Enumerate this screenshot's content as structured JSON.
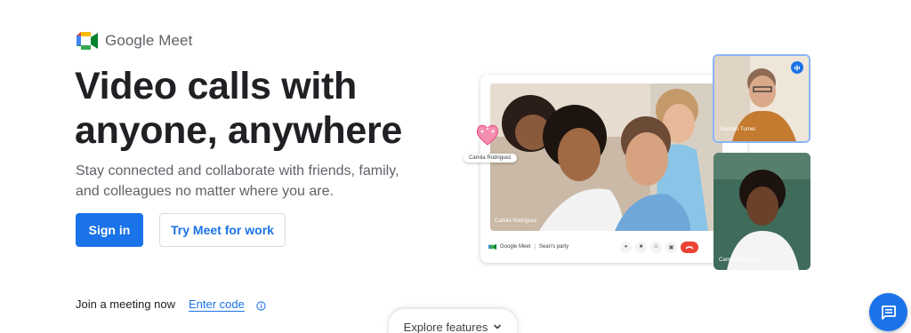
{
  "brand": {
    "name": "Google Meet",
    "icon": "google-meet-logo",
    "colors": {
      "blue": "#4285f4",
      "green": "#34a853",
      "yellow": "#fbbc04",
      "red": "#ea4335"
    }
  },
  "hero": {
    "title_line1": "Video calls with",
    "title_line2": "anyone, anywhere",
    "subtitle": "Stay connected and collaborate with friends, family, and colleagues no matter where you are."
  },
  "actions": {
    "sign_in": "Sign in",
    "try_meet": "Try Meet for work"
  },
  "join": {
    "label": "Join a meeting now",
    "enter_code": "Enter code",
    "info_icon": "info-icon"
  },
  "explore": {
    "label": "Explore features",
    "icon": "chevron-down-icon"
  },
  "chat": {
    "icon": "chat-icon"
  },
  "illustration": {
    "main_participant": "Camila Rodriguez",
    "reaction_chip": "Camila Rodriguez",
    "call_brand": "Google Meet",
    "meeting_name": "Sean's party",
    "tile1_name": "Stephen Turner",
    "tile2_name": "Camila Rodriguez",
    "accent": "#1a73e8",
    "end_call_color": "#ea4335"
  }
}
